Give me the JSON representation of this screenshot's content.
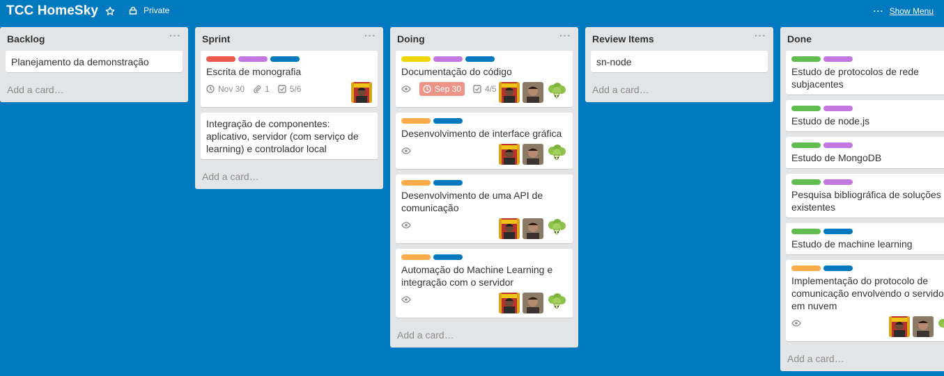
{
  "board": {
    "title": "TCC HomeSky",
    "privacy": "Private",
    "show_menu": "Show Menu",
    "menu_dots": "···"
  },
  "colors": {
    "red": "#eb5a46",
    "purple": "#c377e0",
    "blue": "#0079bf",
    "yellow": "#f2d600",
    "orange": "#ffab4a",
    "green": "#61bd4f"
  },
  "lists": [
    {
      "title": "Backlog",
      "add_card": "Add a card…",
      "cards": [
        {
          "title": "Planejamento da demonstração"
        }
      ]
    },
    {
      "title": "Sprint",
      "add_card": "Add a card…",
      "cards": [
        {
          "title": "Escrita de monografia",
          "labels": [
            "red",
            "purple",
            "blue"
          ],
          "due": "Nov 30",
          "attachments": "1",
          "checklist": "5/6",
          "members": [
            "person-a"
          ]
        },
        {
          "title": "Integração de componentes: aplicativo, servidor (com serviço de learning) e controlador local"
        }
      ]
    },
    {
      "title": "Doing",
      "add_card": "Add a card…",
      "cards": [
        {
          "title": "Documentação do código",
          "labels": [
            "yellow",
            "purple",
            "blue"
          ],
          "watch": true,
          "due": "Sep 30",
          "due_late": true,
          "checklist": "4/5",
          "members": [
            "person-a",
            "person-b",
            "broccoli"
          ]
        },
        {
          "title": "Desenvolvimento de interface gráfica",
          "labels": [
            "orange",
            "blue"
          ],
          "watch": true,
          "members": [
            "person-a",
            "person-b",
            "broccoli"
          ]
        },
        {
          "title": "Desenvolvimento de uma API de comunicação",
          "labels": [
            "orange",
            "blue"
          ],
          "watch": true,
          "members": [
            "person-a",
            "person-b",
            "broccoli"
          ]
        },
        {
          "title": "Automação do Machine Learning e integração com o servidor",
          "labels": [
            "orange",
            "blue"
          ],
          "watch": true,
          "members": [
            "person-a",
            "person-b",
            "broccoli"
          ]
        }
      ]
    },
    {
      "title": "Review Items",
      "add_card": "Add a card…",
      "cards": [
        {
          "title": "sn-node"
        }
      ]
    },
    {
      "title": "Done",
      "add_card": "Add a card…",
      "cards": [
        {
          "title": "Estudo de protocolos de rede subjacentes",
          "labels": [
            "green",
            "purple"
          ]
        },
        {
          "title": "Estudo de node.js",
          "labels": [
            "green",
            "purple"
          ]
        },
        {
          "title": "Estudo de MongoDB",
          "labels": [
            "green",
            "purple"
          ]
        },
        {
          "title": "Pesquisa bibliográfica de soluções existentes",
          "labels": [
            "green",
            "purple"
          ]
        },
        {
          "title": "Estudo de machine learning",
          "labels": [
            "green",
            "blue"
          ]
        },
        {
          "title": "Implementação do protocolo de comunicação envolvendo o servidor em nuvem",
          "labels": [
            "orange",
            "blue"
          ],
          "watch": true,
          "members": [
            "person-a",
            "person-b",
            "broccoli"
          ]
        }
      ]
    }
  ]
}
